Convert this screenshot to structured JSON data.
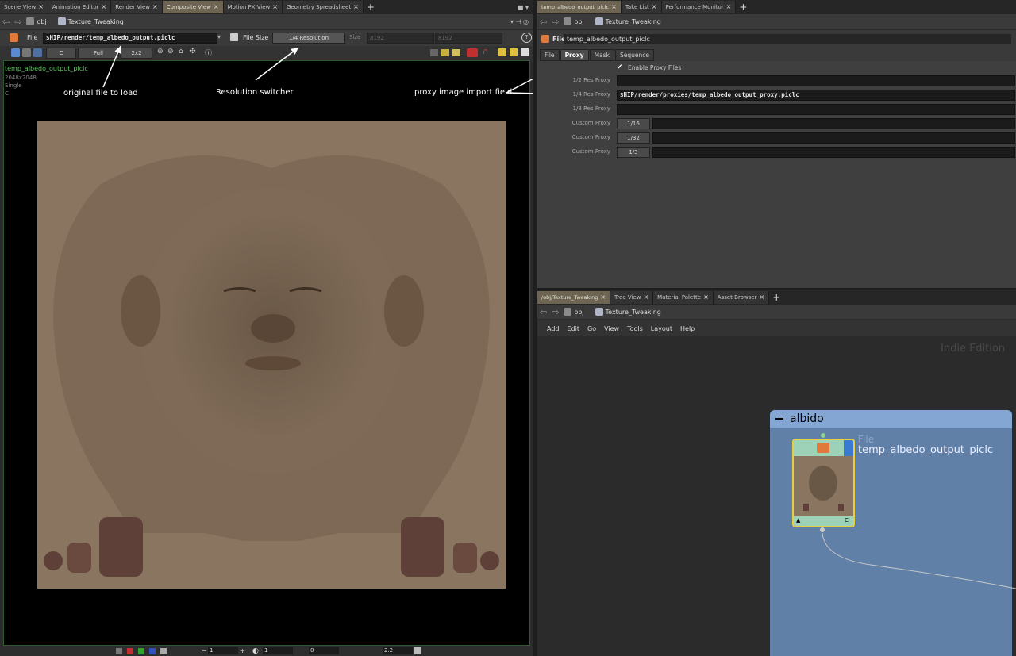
{
  "left_tabs": [
    "Scene View",
    "Animation Editor",
    "Render View",
    "Composite View",
    "Motion FX View",
    "Geometry Spreadsheet"
  ],
  "left_active_tab": "Composite View",
  "path": {
    "obj": "obj",
    "network": "Texture_Tweaking"
  },
  "viewer": {
    "file_label": "File",
    "file_value": "$HIP/render/temp_albedo_output.piclc",
    "filesize_label": "File Size",
    "resolution": "1/4 Resolution",
    "size_label": "Size",
    "size_w": "8192",
    "size_h": "8192",
    "channel": "C",
    "mode": "Full",
    "tile": "2x2",
    "info_name": "temp_albedo_output_piclc",
    "info_res": "2048x2048",
    "info_type": "Single",
    "info_channel": "C",
    "bottom_frame": "1",
    "bottom_val1": "1",
    "bottom_val2": "0",
    "bottom_gamma": "2.2"
  },
  "annotations": {
    "a1": "original file to load",
    "a2": "Resolution switcher",
    "a3": "proxy image import field"
  },
  "right_top_tabs": [
    "temp_albedo_output_piclc",
    "Take List",
    "Performance Monitor"
  ],
  "params": {
    "node_type": "File",
    "node_name": "temp_albedo_output_piclc",
    "tabs": [
      "File",
      "Proxy",
      "Mask",
      "Sequence"
    ],
    "active_tab": "Proxy",
    "enable_label": "Enable Proxy Files",
    "rows": [
      {
        "label": "1/2 Res Proxy",
        "value": ""
      },
      {
        "label": "1/4 Res Proxy",
        "value": "$HIP/render/proxies/temp_albedo_output_proxy.piclc"
      },
      {
        "label": "1/8 Res Proxy",
        "value": ""
      }
    ],
    "custom": [
      {
        "label": "Custom Proxy",
        "value": "1/16"
      },
      {
        "label": "Custom Proxy",
        "value": "1/32"
      },
      {
        "label": "Custom Proxy",
        "value": "1/3"
      }
    ]
  },
  "right_bottom_tabs": [
    "/obj/Texture_Tweaking",
    "Tree View",
    "Material Palette",
    "Asset Browser"
  ],
  "network": {
    "menu": [
      "Add",
      "Edit",
      "Go",
      "View",
      "Tools",
      "Layout",
      "Help"
    ],
    "watermark": "Indie Edition",
    "box_title": "albido",
    "node_type": "File",
    "node_name": "temp_albedo_output_piclc",
    "node_flag_left": "▲",
    "node_flag_right": "C"
  }
}
